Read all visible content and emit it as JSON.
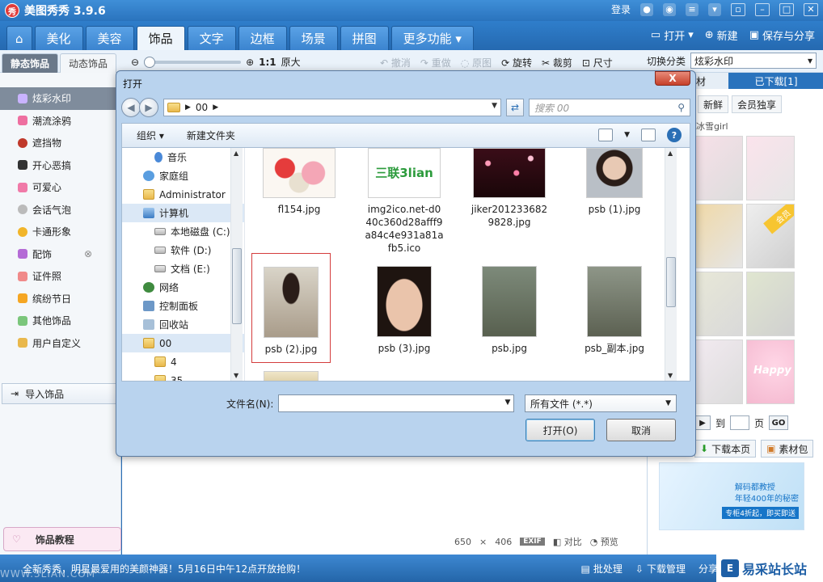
{
  "app": {
    "title": "美图秀秀 3.9.6",
    "logo_text": "秀",
    "login": "登录"
  },
  "main_tabs": [
    {
      "label": "美化"
    },
    {
      "label": "美容"
    },
    {
      "label": "饰品"
    },
    {
      "label": "文字"
    },
    {
      "label": "边框"
    },
    {
      "label": "场景"
    },
    {
      "label": "拼图"
    },
    {
      "label": "更多功能 ▾"
    }
  ],
  "top_actions": {
    "open": "打开",
    "new": "新建",
    "save_share": "保存与分享"
  },
  "toolbar": {
    "sub_tabs": [
      "静态饰品",
      "动态饰品"
    ],
    "ratio": "1:1",
    "original_size": "原大",
    "undo": "撤消",
    "redo": "重做",
    "original": "原图",
    "rotate": "旋转",
    "crop": "裁剪",
    "size": "尺寸",
    "switch_category": "切换分类",
    "category_value": "炫彩水印"
  },
  "categories": [
    {
      "label": "炫彩水印"
    },
    {
      "label": "潮流涂鸦"
    },
    {
      "label": "遮挡物"
    },
    {
      "label": "开心恶搞"
    },
    {
      "label": "可爱心"
    },
    {
      "label": "会话气泡"
    },
    {
      "label": "卡通形象"
    },
    {
      "label": "配饰"
    },
    {
      "label": "证件照"
    },
    {
      "label": "缤纷节日"
    },
    {
      "label": "其他饰品"
    },
    {
      "label": "用户自定义"
    }
  ],
  "left_buttons": {
    "import": "导入饰品",
    "tutorial": "饰品教程"
  },
  "right_panel": {
    "tab_material": "材",
    "tab_downloaded": "已下载[1]",
    "subtab_new": "新鲜",
    "subtab_vip": "会员独享",
    "author": "冰雪girl",
    "vip_ribbon": "会员",
    "happy": "Happy",
    "page_to": "到",
    "page_unit": "页",
    "go": "GO",
    "download_page": "下载本页",
    "material_pack": "素材包",
    "ad_line1": "解码都教授",
    "ad_line2": "年轻400年的秘密",
    "ad_badge": "专柜4折起，即买即送"
  },
  "canvas_info": {
    "width": "650",
    "times": "×",
    "height": "406",
    "exif": "EXIF",
    "compare": "对比",
    "preview": "预览"
  },
  "statusbar": {
    "message": "全新秀秀，明星最爱用的美颜神器！5月16日中午12点开放抢购！",
    "watermark": "WWW.3LIAN.COM",
    "batch": "批处理",
    "download_manager": "下载管理",
    "share": "分享",
    "brand": "易采站长站",
    "brand_mark": "E"
  },
  "dialog": {
    "title": "打开",
    "close": "X",
    "path": "00",
    "search_placeholder": "搜索 00",
    "organize": "组织 ▾",
    "new_folder": "新建文件夹",
    "help": "?",
    "tree": [
      {
        "label": "音乐",
        "icon": "music-icon"
      },
      {
        "label": "家庭组",
        "icon": "homegroup-icon"
      },
      {
        "label": "Administrator",
        "icon": "user-folder-icon"
      },
      {
        "label": "计算机",
        "icon": "computer-icon"
      },
      {
        "label": "本地磁盘 (C:)",
        "icon": "drive-icon"
      },
      {
        "label": "软件 (D:)",
        "icon": "drive-icon"
      },
      {
        "label": "文档 (E:)",
        "icon": "drive-icon"
      },
      {
        "label": "网络",
        "icon": "network-icon"
      },
      {
        "label": "控制面板",
        "icon": "control-panel-icon"
      },
      {
        "label": "回收站",
        "icon": "recycle-bin-icon"
      },
      {
        "label": "00",
        "icon": "folder-icon"
      },
      {
        "label": "4",
        "icon": "folder-icon"
      },
      {
        "label": "35",
        "icon": "folder-icon"
      }
    ],
    "files": [
      {
        "name": "fl154.jpg"
      },
      {
        "name": "img2ico.net-d040c360d28afff9a84c4e931a81afb5.ico",
        "thumb_text": "三联3lian"
      },
      {
        "name": "jiker2012336829828.jpg"
      },
      {
        "name": "psb (1).jpg"
      },
      {
        "name": "psb (2).jpg"
      },
      {
        "name": "psb (3).jpg"
      },
      {
        "name": "psb.jpg"
      },
      {
        "name": "psb_副本.jpg"
      }
    ],
    "filename_label": "文件名(N):",
    "filename_value": "",
    "filetype": "所有文件 (*.*)",
    "open_button": "打开(O)",
    "cancel_button": "取消"
  },
  "colors": {
    "title_blue": "#2a73bd",
    "accent_red": "#d43c3c",
    "dialog_frame": "#b9d3ee"
  }
}
